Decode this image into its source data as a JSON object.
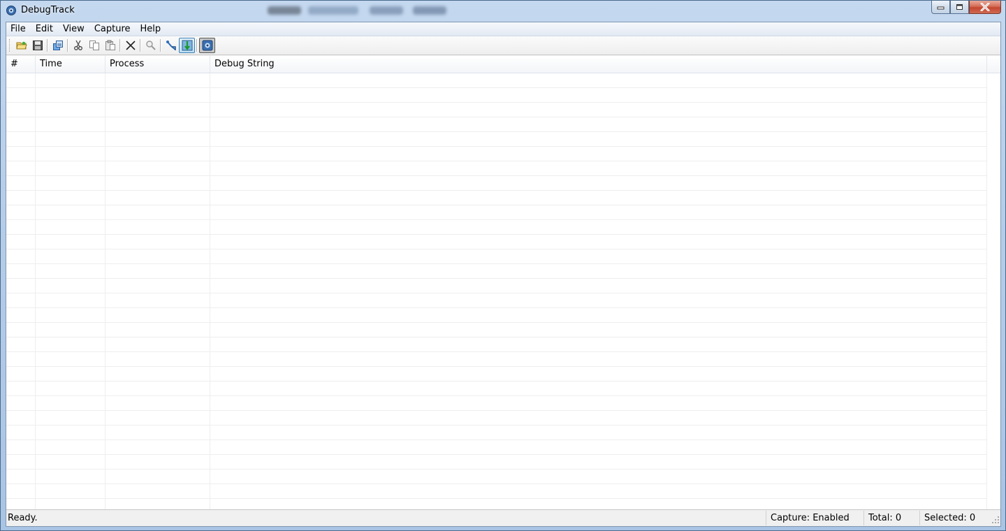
{
  "window": {
    "title": "DebugTrack"
  },
  "menu": [
    {
      "key": "file",
      "label": "File"
    },
    {
      "key": "edit",
      "label": "Edit"
    },
    {
      "key": "view",
      "label": "View"
    },
    {
      "key": "capture",
      "label": "Capture"
    },
    {
      "key": "help",
      "label": "Help"
    }
  ],
  "toolbar": {
    "buttons": [
      {
        "icon": "open-folder-icon"
      },
      {
        "icon": "save-icon"
      },
      {
        "icon": "copy-window-icon"
      },
      {
        "icon": "cut-icon"
      },
      {
        "icon": "copy-icon"
      },
      {
        "icon": "paste-icon"
      },
      {
        "icon": "delete-icon"
      },
      {
        "icon": "find-icon"
      },
      {
        "icon": "filter-icon"
      },
      {
        "icon": "autoscroll-icon"
      },
      {
        "icon": "capture-icon"
      }
    ]
  },
  "list": {
    "columns": [
      {
        "key": "num",
        "label": "#"
      },
      {
        "key": "time",
        "label": "Time"
      },
      {
        "key": "process",
        "label": "Process"
      },
      {
        "key": "debug",
        "label": "Debug String"
      }
    ],
    "rows": []
  },
  "status": {
    "message": "Ready.",
    "capture": "Capture: Enabled",
    "total": "Total: 0",
    "selected": "Selected: 0"
  },
  "colors": {
    "title_gradient_top": "#c4d8ef",
    "close_button": "#c4462f",
    "toolbar_active_border": "#3c7fb1"
  }
}
